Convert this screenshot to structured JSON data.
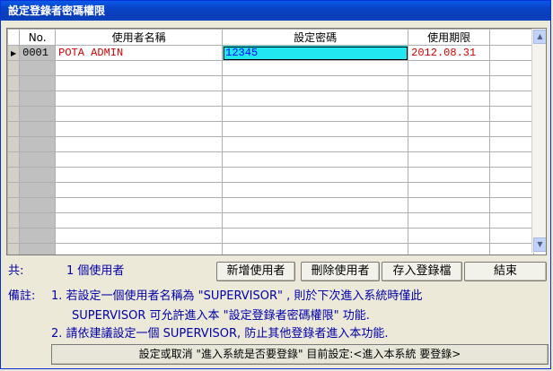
{
  "window": {
    "title": "設定登錄者密碼權限"
  },
  "grid": {
    "columns": [
      "No.",
      "使用者名稱",
      "設定密碼",
      "使用期限"
    ],
    "rows": [
      {
        "no": "0001",
        "name": "POTA ADMIN",
        "password": "12345",
        "expiry": "2012.08.31"
      }
    ],
    "row_indicator": "▶"
  },
  "summary": {
    "label": "共:",
    "count_text": "1 個使用者"
  },
  "buttons": {
    "add": "新增使用者",
    "delete": "刪除使用者",
    "save": "存入登錄檔",
    "close": "結束",
    "toggle_login": "設定或取消 \"進入系統是否要登錄\" 目前設定:<進入本系統 要登錄>"
  },
  "notes": {
    "label": "備註:",
    "line1": "1. 若設定一個使用者名稱為 \"SUPERVISOR\" , 則於下次進入系統時僅此",
    "line2": "SUPERVISOR 可允許進入本 \"設定登錄者密碼權限\" 功能.",
    "line3": "2. 請依建議設定一個 SUPERVISOR,  防止其他登錄者進入本功能."
  }
}
